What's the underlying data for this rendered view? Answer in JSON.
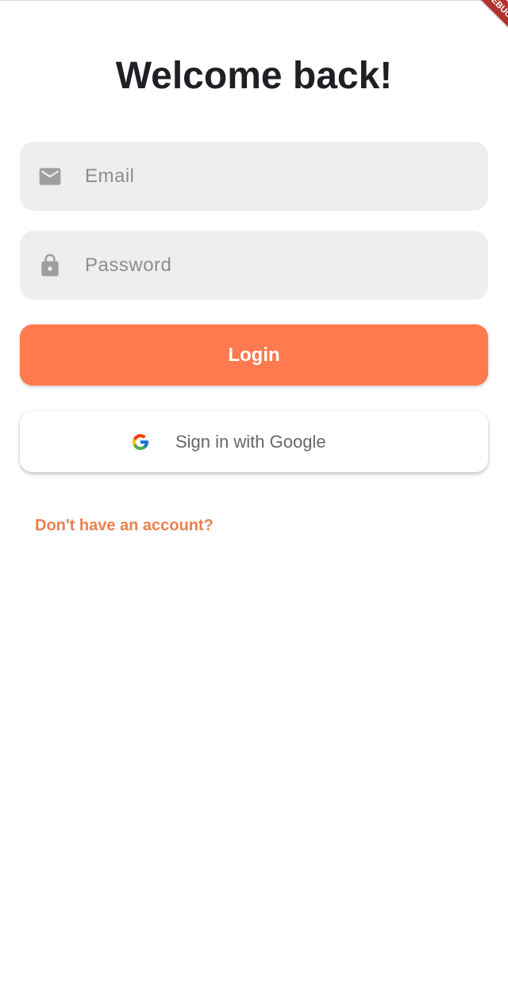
{
  "banner": {
    "label": "DEBUG"
  },
  "header": {
    "title": "Welcome back!"
  },
  "form": {
    "email": {
      "placeholder": "Email",
      "value": ""
    },
    "password": {
      "placeholder": "Password",
      "value": ""
    },
    "login_label": "Login",
    "google_label": "Sign in with Google"
  },
  "footer": {
    "signup_link": "Don't have an account?"
  },
  "icons": {
    "email": "mail-icon",
    "password": "lock-icon",
    "google": "google-g-icon"
  },
  "colors": {
    "accent": "#ff7a4f",
    "link": "#e8814f",
    "field_bg": "#eeeeee",
    "icon": "#9e9e9e",
    "title": "#1f1f24",
    "banner": "#b0342d"
  }
}
